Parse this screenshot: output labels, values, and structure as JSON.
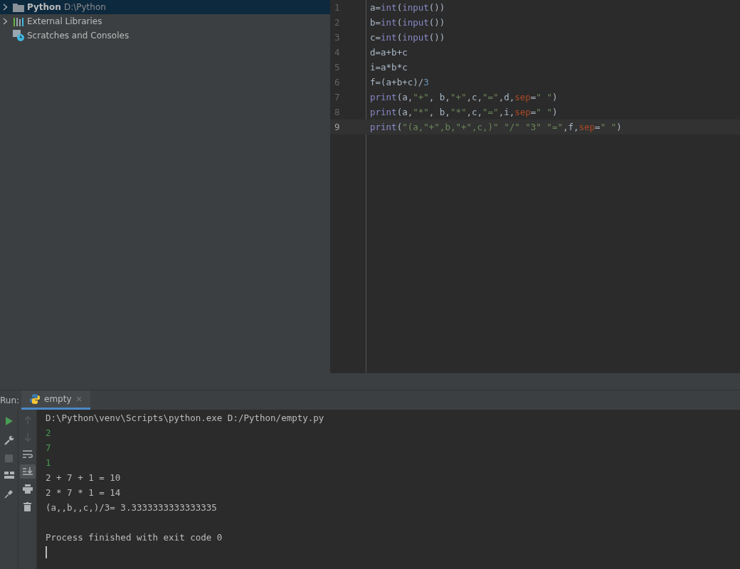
{
  "project_tree": [
    {
      "label": "Python",
      "path": "D:\\Python",
      "kind": "folder",
      "expandable": true,
      "selected": true
    },
    {
      "label": "External Libraries",
      "kind": "libraries",
      "expandable": true,
      "selected": false
    },
    {
      "label": "Scratches and Consoles",
      "kind": "scratches",
      "expandable": false,
      "selected": false
    }
  ],
  "editor": {
    "lines": [
      {
        "number": "1",
        "current": false,
        "tokens": [
          {
            "text": "a=",
            "kind": "plain"
          },
          {
            "text": "int",
            "kind": "builtin"
          },
          {
            "text": "(",
            "kind": "plain"
          },
          {
            "text": "input",
            "kind": "builtin"
          },
          {
            "text": "())",
            "kind": "plain"
          }
        ]
      },
      {
        "number": "2",
        "current": false,
        "tokens": [
          {
            "text": "b=",
            "kind": "plain"
          },
          {
            "text": "int",
            "kind": "builtin"
          },
          {
            "text": "(",
            "kind": "plain"
          },
          {
            "text": "input",
            "kind": "builtin"
          },
          {
            "text": "())",
            "kind": "plain"
          }
        ]
      },
      {
        "number": "3",
        "current": false,
        "tokens": [
          {
            "text": "c=",
            "kind": "plain"
          },
          {
            "text": "int",
            "kind": "builtin"
          },
          {
            "text": "(",
            "kind": "plain"
          },
          {
            "text": "input",
            "kind": "builtin"
          },
          {
            "text": "())",
            "kind": "plain"
          }
        ]
      },
      {
        "number": "4",
        "current": false,
        "tokens": [
          {
            "text": "d=a+b+c",
            "kind": "plain"
          }
        ]
      },
      {
        "number": "5",
        "current": false,
        "tokens": [
          {
            "text": "i=a*b*c",
            "kind": "plain"
          }
        ]
      },
      {
        "number": "6",
        "current": false,
        "tokens": [
          {
            "text": "f=(a+b+c)/",
            "kind": "plain"
          },
          {
            "text": "3",
            "kind": "number"
          }
        ]
      },
      {
        "number": "7",
        "current": false,
        "tokens": [
          {
            "text": "print",
            "kind": "builtin"
          },
          {
            "text": "(a,",
            "kind": "plain"
          },
          {
            "text": "\"+\"",
            "kind": "string"
          },
          {
            "text": ", b,",
            "kind": "plain"
          },
          {
            "text": "\"+\"",
            "kind": "string"
          },
          {
            "text": ",c,",
            "kind": "plain"
          },
          {
            "text": "\"=\"",
            "kind": "string"
          },
          {
            "text": ",d,",
            "kind": "plain"
          },
          {
            "text": "sep",
            "kind": "param"
          },
          {
            "text": "=",
            "kind": "plain"
          },
          {
            "text": "\" \"",
            "kind": "string"
          },
          {
            "text": ")",
            "kind": "plain"
          }
        ]
      },
      {
        "number": "8",
        "current": false,
        "tokens": [
          {
            "text": "print",
            "kind": "builtin"
          },
          {
            "text": "(a,",
            "kind": "plain"
          },
          {
            "text": "\"*\"",
            "kind": "string"
          },
          {
            "text": ", b,",
            "kind": "plain"
          },
          {
            "text": "\"*\"",
            "kind": "string"
          },
          {
            "text": ",c,",
            "kind": "plain"
          },
          {
            "text": "\"=\"",
            "kind": "string"
          },
          {
            "text": ",i,",
            "kind": "plain"
          },
          {
            "text": "sep",
            "kind": "param"
          },
          {
            "text": "=",
            "kind": "plain"
          },
          {
            "text": "\" \"",
            "kind": "string"
          },
          {
            "text": ")",
            "kind": "plain"
          }
        ]
      },
      {
        "number": "9",
        "current": true,
        "tokens": [
          {
            "text": "print",
            "kind": "builtin"
          },
          {
            "text": "(",
            "kind": "plain"
          },
          {
            "text": "\"(a,\"+\",b,\"+\",c,)\" \"/\" \"3\" \"=\"",
            "kind": "string"
          },
          {
            "text": ",f,",
            "kind": "plain"
          },
          {
            "text": "sep",
            "kind": "param"
          },
          {
            "text": "=",
            "kind": "plain"
          },
          {
            "text": "\" \"",
            "kind": "string"
          },
          {
            "text": ")",
            "kind": "plain"
          }
        ]
      }
    ]
  },
  "run_panel": {
    "label": "Run:",
    "tabs": [
      {
        "label": "empty",
        "selected": true
      }
    ],
    "console": [
      {
        "text": "D:\\Python\\venv\\Scripts\\python.exe D:/Python/empty.py",
        "kind": "output"
      },
      {
        "text": "2",
        "kind": "input"
      },
      {
        "text": "7",
        "kind": "input"
      },
      {
        "text": "1",
        "kind": "input"
      },
      {
        "text": "2 + 7 + 1 = 10",
        "kind": "output"
      },
      {
        "text": "2 * 7 * 1 = 14",
        "kind": "output"
      },
      {
        "text": "(a,,b,,c,)/3= 3.3333333333333335",
        "kind": "output"
      },
      {
        "kind": "blank"
      },
      {
        "text": "Process finished with exit code 0",
        "kind": "output"
      }
    ]
  }
}
